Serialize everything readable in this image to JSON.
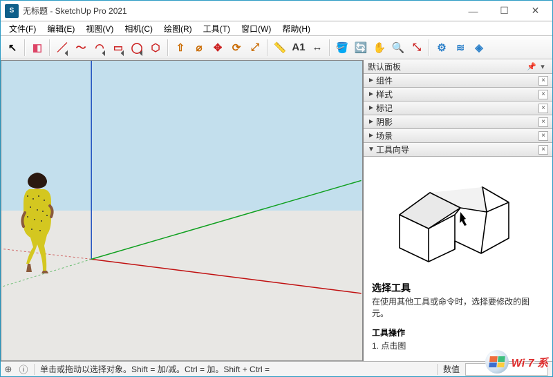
{
  "window": {
    "title": "无标题 - SketchUp Pro 2021",
    "app_icon_label": "S"
  },
  "menu": {
    "items": [
      "文件(F)",
      "编辑(E)",
      "视图(V)",
      "相机(C)",
      "绘图(R)",
      "工具(T)",
      "窗口(W)",
      "帮助(H)"
    ]
  },
  "toolbar": {
    "groups": [
      [
        "select"
      ],
      [
        "eraser"
      ],
      [
        "line",
        "freehand",
        "arc",
        "rect",
        "circle",
        "polygon"
      ],
      [
        "pushpull",
        "offset",
        "move",
        "rotate",
        "scale"
      ],
      [
        "tape",
        "text",
        "dim"
      ],
      [
        "paint",
        "orbit",
        "pan",
        "zoom",
        "zoom-extents"
      ],
      [
        "warehouse",
        "ext-mgr",
        "ext-whs"
      ]
    ],
    "icons": {
      "select": "↖",
      "eraser": "◧",
      "line": "／",
      "freehand": "〜",
      "arc": "◠",
      "rect": "▭",
      "circle": "◯",
      "polygon": "⬡",
      "pushpull": "⇧",
      "offset": "⌀",
      "move": "✥",
      "rotate": "⟳",
      "scale": "⤢",
      "tape": "📏",
      "text": "A1",
      "dim": "↔",
      "paint": "🪣",
      "orbit": "🔄",
      "pan": "✋",
      "zoom": "🔍",
      "zoom-extents": "⤡",
      "warehouse": "⚙",
      "ext-mgr": "≋",
      "ext-whs": "◈"
    },
    "dropdown": [
      "line",
      "arc",
      "rect",
      "circle"
    ],
    "colors": {
      "select": "#000",
      "eraser": "#d46",
      "line": "#c22",
      "freehand": "#c22",
      "arc": "#c22",
      "rect": "#c22",
      "circle": "#c22",
      "polygon": "#c22",
      "pushpull": "#c96a00",
      "offset": "#c96a00",
      "move": "#c22",
      "rotate": "#c96a00",
      "scale": "#c96a00",
      "tape": "#c96a00",
      "text": "#333",
      "dim": "#333",
      "paint": "#b58a00",
      "orbit": "#2a7",
      "pan": "#cb9",
      "zoom": "#357",
      "zoom-extents": "#c22",
      "warehouse": "#2a7fc9",
      "ext-mgr": "#2a7fc9",
      "ext-whs": "#2a7fc9"
    }
  },
  "panel": {
    "title": "默认面板",
    "sections": [
      {
        "label": "组件",
        "expanded": false
      },
      {
        "label": "样式",
        "expanded": false
      },
      {
        "label": "标记",
        "expanded": false
      },
      {
        "label": "阴影",
        "expanded": false
      },
      {
        "label": "场景",
        "expanded": false
      },
      {
        "label": "工具向导",
        "expanded": true
      }
    ],
    "instructor": {
      "title": "选择工具",
      "desc": "在使用其他工具或命令时，选择要修改的图元。",
      "ops_title": "工具操作",
      "step1": "1. 点击图"
    }
  },
  "status": {
    "hint": "单击或拖动以选择对象。Shift = 加/减。Ctrl = 加。Shift + Ctrl = ",
    "measure_label": "数值"
  },
  "watermark": {
    "text": "Wi 7 系"
  }
}
